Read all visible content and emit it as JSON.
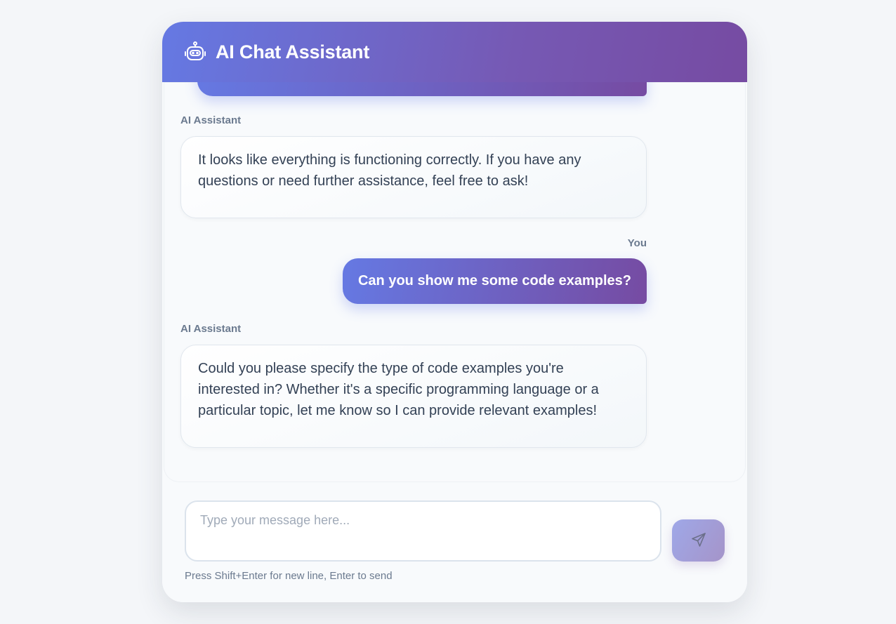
{
  "header": {
    "title": "AI Chat Assistant",
    "icon": "robot-icon"
  },
  "messages": [
    {
      "role": "ai",
      "sender": "AI Assistant",
      "text": "It looks like everything is functioning correctly. If you have any questions or need further assistance, feel free to ask!"
    },
    {
      "role": "user",
      "sender": "You",
      "text": "Can you show me some code examples?"
    },
    {
      "role": "ai",
      "sender": "AI Assistant",
      "text": "Could you please specify the type of code examples you're interested in? Whether it's a specific programming language or a particular topic, let me know so I can provide relevant examples!"
    }
  ],
  "input": {
    "placeholder": "Type your message here...",
    "value": "",
    "hint": "Press Shift+Enter for new line, Enter to send",
    "send_icon": "send-icon"
  },
  "colors": {
    "accent_start": "#667eea",
    "accent_end": "#764ba2",
    "sender_label": "#6b7a8f",
    "ai_text": "#334155"
  }
}
